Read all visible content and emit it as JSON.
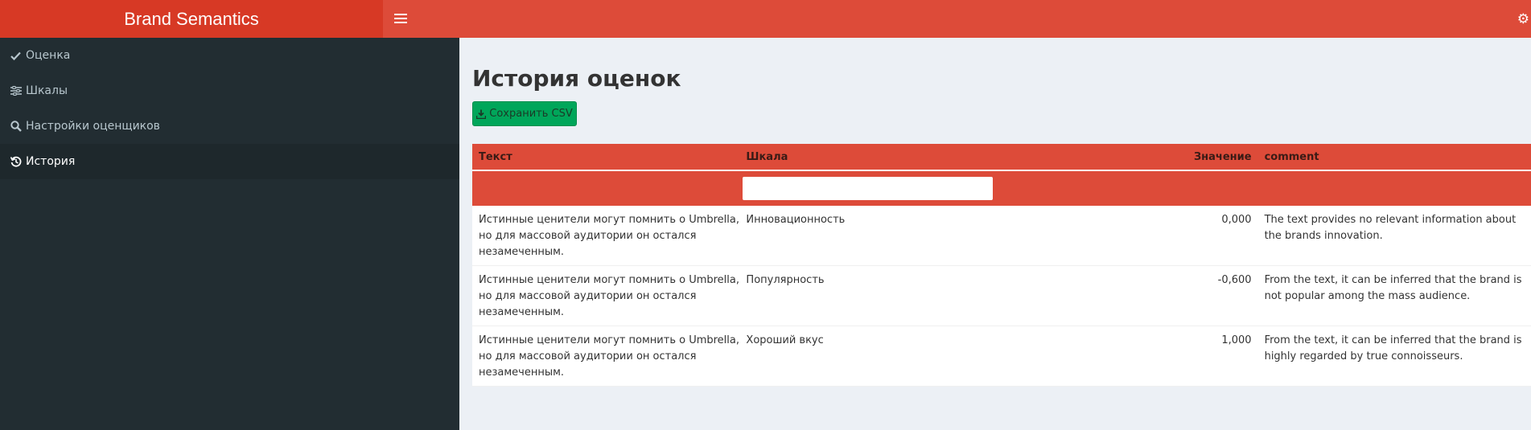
{
  "app_title": "Brand Semantics",
  "sidebar": {
    "items": [
      {
        "label": "Оценка",
        "icon": "check-icon"
      },
      {
        "label": "Шкалы",
        "icon": "sliders-icon"
      },
      {
        "label": "Настройки оценщиков",
        "icon": "search-icon"
      },
      {
        "label": "История",
        "icon": "history-icon",
        "active": true
      }
    ]
  },
  "main": {
    "title": "История оценок",
    "save_button": "Сохранить CSV",
    "table": {
      "columns": [
        "Текст",
        "Шкала",
        "Значение",
        "comment"
      ],
      "rows": [
        {
          "text": "Истинные ценители могут помнить о Umbrella, но для массовой аудитории он остался незамеченным.",
          "scale": "Инновационность",
          "value": "0,000",
          "comment": "The text provides no relevant information about the brands innovation."
        },
        {
          "text": "Истинные ценители могут помнить о Umbrella, но для массовой аудитории он остался незамеченным.",
          "scale": "Популярность",
          "value": "-0,600",
          "comment": "From the text, it can be inferred that the brand is not popular among the mass audience."
        },
        {
          "text": "Истинные ценители могут помнить о Umbrella, но для массовой аудитории он остался незамеченным.",
          "scale": "Хороший вкус",
          "value": "1,000",
          "comment": "From the text, it can be inferred that the brand is highly regarded by true connoisseurs."
        }
      ]
    }
  },
  "colors": {
    "header": "#dd4b39",
    "logo": "#d73925",
    "sidebar": "#222d32",
    "button": "#00a65a"
  }
}
